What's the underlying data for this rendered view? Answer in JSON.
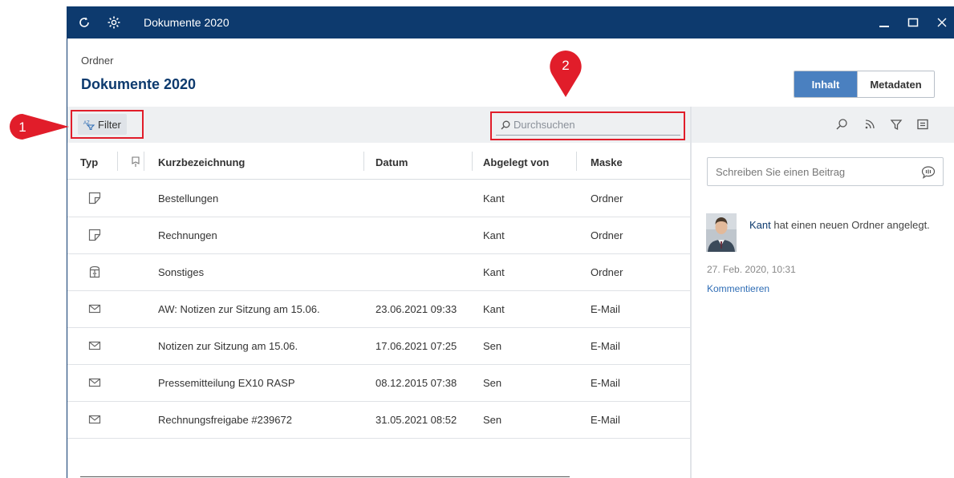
{
  "window": {
    "title": "Dokumente 2020"
  },
  "header": {
    "label": "Ordner",
    "title": "Dokumente 2020"
  },
  "view_tabs": {
    "active": "Inhalt",
    "inactive": "Metadaten"
  },
  "toolbar": {
    "filter_label": "Filter",
    "search_placeholder": "Durchsuchen"
  },
  "table": {
    "columns": {
      "type": "Typ",
      "name": "Kurzbezeichnung",
      "date": "Datum",
      "filed_by": "Abgelegt von",
      "mask": "Maske"
    },
    "rows": [
      {
        "icon": "folder-icon",
        "name": "Bestellungen",
        "date": "",
        "filed_by": "Kant",
        "mask": "Ordner"
      },
      {
        "icon": "folder-icon",
        "name": "Rechnungen",
        "date": "",
        "filed_by": "Kant",
        "mask": "Ordner"
      },
      {
        "icon": "cabinet-icon",
        "name": "Sonstiges",
        "date": "",
        "filed_by": "Kant",
        "mask": "Ordner"
      },
      {
        "icon": "mail-icon",
        "name": "AW: Notizen zur Sitzung am 15.06.",
        "date": "23.06.2021 09:33",
        "filed_by": "Kant",
        "mask": "E-Mail"
      },
      {
        "icon": "mail-icon",
        "name": "Notizen zur Sitzung am 15.06.",
        "date": "17.06.2021 07:25",
        "filed_by": "Sen",
        "mask": "E-Mail"
      },
      {
        "icon": "mail-icon",
        "name": "Pressemitteilung EX10 RASP",
        "date": "08.12.2015 07:38",
        "filed_by": "Sen",
        "mask": "E-Mail"
      },
      {
        "icon": "mail-icon",
        "name": "Rechnungsfreigabe #239672",
        "date": "31.05.2021 08:52",
        "filed_by": "Sen",
        "mask": "E-Mail"
      }
    ]
  },
  "feed": {
    "input_placeholder": "Schreiben Sie einen Beitrag",
    "user": "Kant",
    "message": " hat einen neuen Ordner angelegt.",
    "timestamp": "27. Feb. 2020, 10:31",
    "comment_label": "Kommentieren"
  },
  "markers": [
    {
      "label": "1"
    },
    {
      "label": "2"
    }
  ],
  "colors": {
    "titlebar": "#0d3a6e",
    "accent": "#4a80c0",
    "marker": "#e11d2a"
  }
}
